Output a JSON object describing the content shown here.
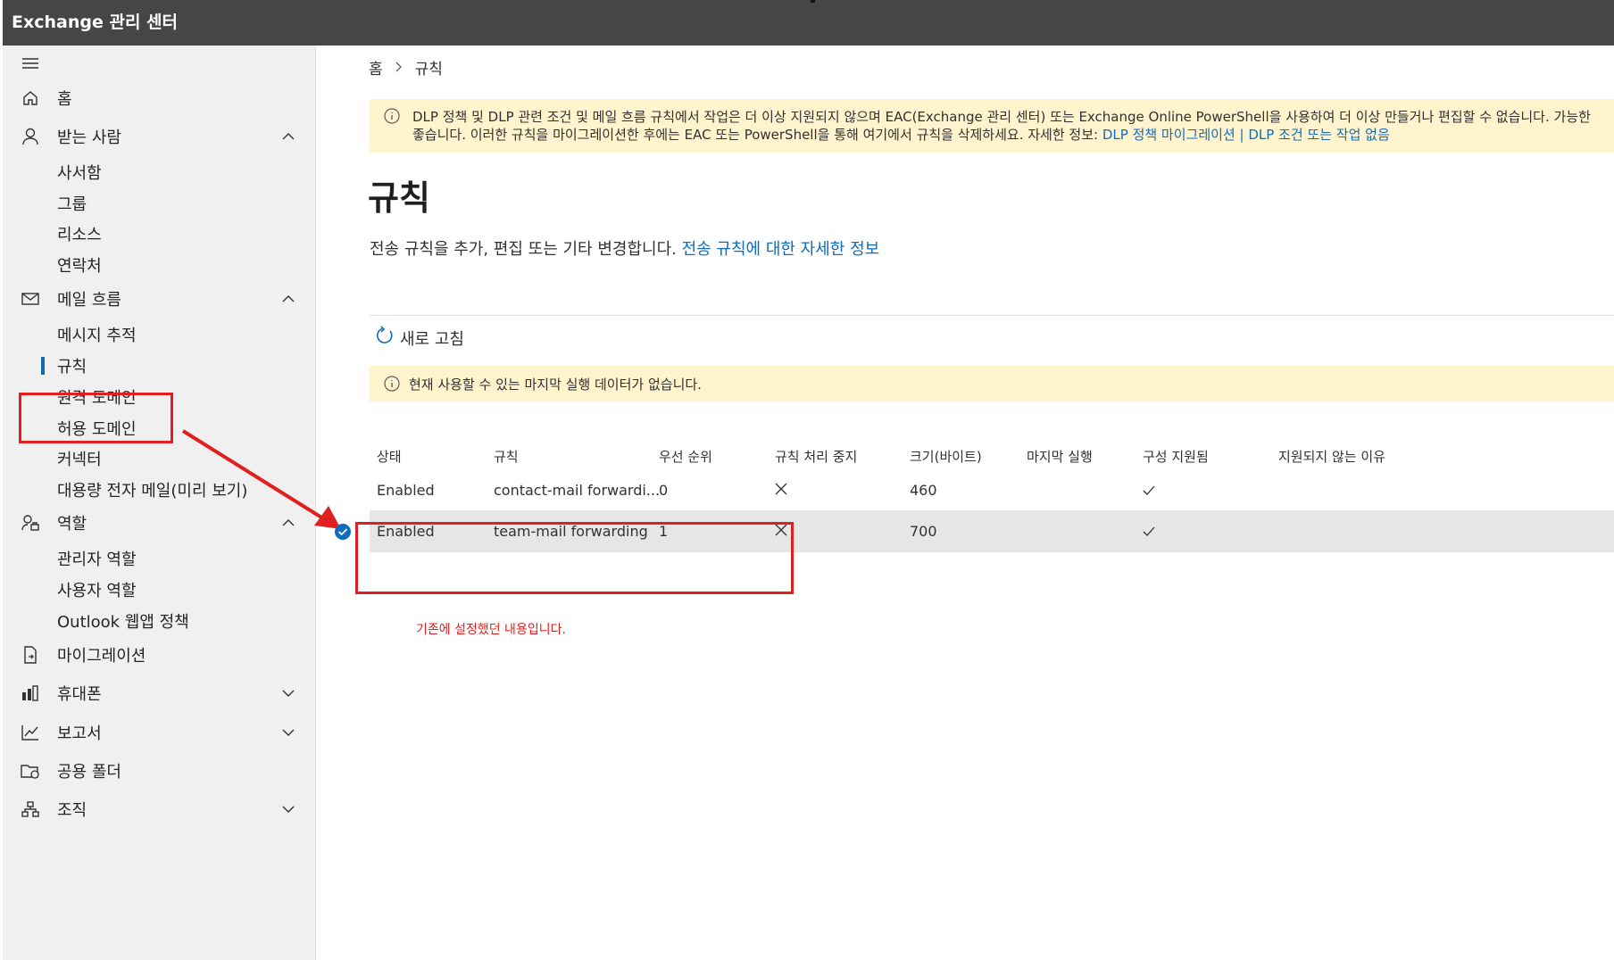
{
  "app": {
    "title": "Exchange 관리 센터"
  },
  "sidebar": {
    "items": [
      {
        "label": "홈",
        "icon": "home-icon"
      },
      {
        "label": "받는 사람",
        "icon": "person-icon",
        "children": [
          "사서함",
          "그룹",
          "리소스",
          "연락처"
        ]
      },
      {
        "label": "메일 흐름",
        "icon": "mail-icon",
        "children": [
          "메시지 추적",
          "규칙",
          "원격 도메인",
          "허용 도메인",
          "커넥터",
          "대용량 전자 메일(미리 보기)"
        ]
      },
      {
        "label": "역할",
        "icon": "role-icon",
        "children": [
          "관리자 역할",
          "사용자 역할",
          "Outlook 웹앱 정책"
        ]
      },
      {
        "label": "마이그레이션",
        "icon": "migration-icon"
      },
      {
        "label": "휴대폰",
        "icon": "mobile-icon"
      },
      {
        "label": "보고서",
        "icon": "chart-icon"
      },
      {
        "label": "공용 폴더",
        "icon": "folder-icon"
      },
      {
        "label": "조직",
        "icon": "org-icon"
      }
    ],
    "selected": "규칙"
  },
  "breadcrumb": {
    "home": "홈",
    "current": "규칙"
  },
  "warning": {
    "line1": "DLP 정책 및 DLP 관련 조건 및 메일 흐름 규칙에서 작업은 더 이상 지원되지 않으며 EAC(Exchange 관리 센터) 또는 Exchange Online PowerShell을 사용하여 더 이상 만들거나 편집할 수 없습니다. 가능한",
    "line2_prefix": "좋습니다. 이러한 규칙을 마이그레이션한 후에는 EAC 또는 PowerShell을 통해 여기에서 규칙을 삭제하세요. 자세한 정보: ",
    "link1": "DLP 정책 마이그레이션",
    "sep": " | ",
    "link2": "DLP 조건 또는 작업 없음"
  },
  "page": {
    "title": "규칙",
    "description": "전송 규칙을 추가, 편집 또는 기타 변경합니다. ",
    "description_link": "전송 규칙에 대한 자세한 정보"
  },
  "toolbar": {
    "refresh": "새로 고침"
  },
  "info": {
    "text": "현재 사용할 수 있는 마지막 실행 데이터가 없습니다."
  },
  "table": {
    "headers": [
      "상태",
      "규칙",
      "우선 순위",
      "규칙 처리 중지",
      "크기(바이트)",
      "마지막 실행",
      "구성 지원됨",
      "지원되지 않는 이유"
    ],
    "rows": [
      {
        "status": "Enabled",
        "rule": "contact-mail forwardi...",
        "priority": "0",
        "size": "460",
        "selected": false
      },
      {
        "status": "Enabled",
        "rule": "team-mail forwarding",
        "priority": "1",
        "size": "700",
        "selected": true
      }
    ]
  },
  "annotation": {
    "note": "기존에 설정했던 내용입니다."
  },
  "colors": {
    "accent": "#0f6cbd",
    "highlight": "#e02020",
    "warning_bg": "#fff4ce",
    "topbar": "#464646"
  }
}
